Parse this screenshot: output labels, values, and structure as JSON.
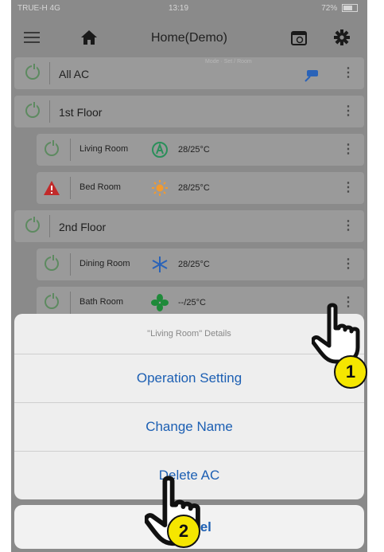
{
  "status_bar": {
    "carrier": "TRUE-H 4G",
    "time": "13:19",
    "battery": "72%"
  },
  "nav": {
    "title": "Home(Demo)",
    "icons": [
      "list-icon",
      "home-icon",
      "calendar-icon",
      "gear-icon"
    ]
  },
  "list": {
    "all": {
      "label": "All AC",
      "hint": "Mode · Set / Room"
    },
    "floor1": {
      "label": "1st Floor"
    },
    "floor2": {
      "label": "2nd Floor"
    },
    "rooms": [
      {
        "name": "Living Room",
        "mode": "auto",
        "temp": "28/25°C"
      },
      {
        "name": "Bed Room",
        "mode": "heat",
        "temp": "28/25°C"
      },
      {
        "name": "Dining Room",
        "mode": "cool",
        "temp": "28/25°C"
      },
      {
        "name": "Bath Room",
        "mode": "fan",
        "temp": "--/25°C"
      }
    ]
  },
  "sheet": {
    "title": "\"Living Room\" Details",
    "options": [
      "Operation Setting",
      "Change Name",
      "Delete AC"
    ],
    "cancel": "Cancel"
  },
  "markers": [
    "1",
    "2"
  ],
  "colors": {
    "accent": "#1c5fb3",
    "power": "#5d8a60",
    "warning": "#c22a2a",
    "marker": "#f5e600"
  }
}
